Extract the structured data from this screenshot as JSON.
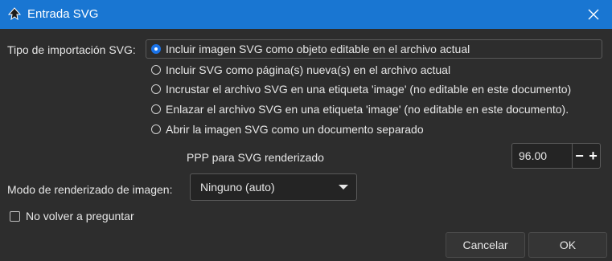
{
  "window": {
    "title": "Entrada SVG",
    "icon": "inkscape-icon",
    "close_icon": "close-icon"
  },
  "import_type": {
    "label": "Tipo de importación SVG:",
    "options": [
      {
        "label": "Incluir imagen SVG como objeto editable en el archivo actual",
        "selected": true
      },
      {
        "label": "Incluir SVG como página(s) nueva(s) en el archivo actual",
        "selected": false
      },
      {
        "label": "Incrustar el archivo SVG en una etiqueta 'image' (no editable en este documento)",
        "selected": false
      },
      {
        "label": "Enlazar el archivo SVG en una etiqueta 'image' (no editable en este documento).",
        "selected": false
      },
      {
        "label": "Abrir la imagen SVG como un documento separado",
        "selected": false
      }
    ]
  },
  "dpi": {
    "label": "PPP para SVG renderizado",
    "value": "96.00",
    "minus": "−",
    "plus": "+"
  },
  "render_mode": {
    "label": "Modo de renderizado de imagen:",
    "value": "Ninguno (auto)"
  },
  "dont_ask": {
    "label": "No volver a preguntar",
    "checked": false
  },
  "buttons": {
    "cancel": "Cancelar",
    "ok": "OK"
  },
  "colors": {
    "titlebar": "#1976d2",
    "background": "#2d2d2d",
    "accent": "#1a73e8"
  }
}
